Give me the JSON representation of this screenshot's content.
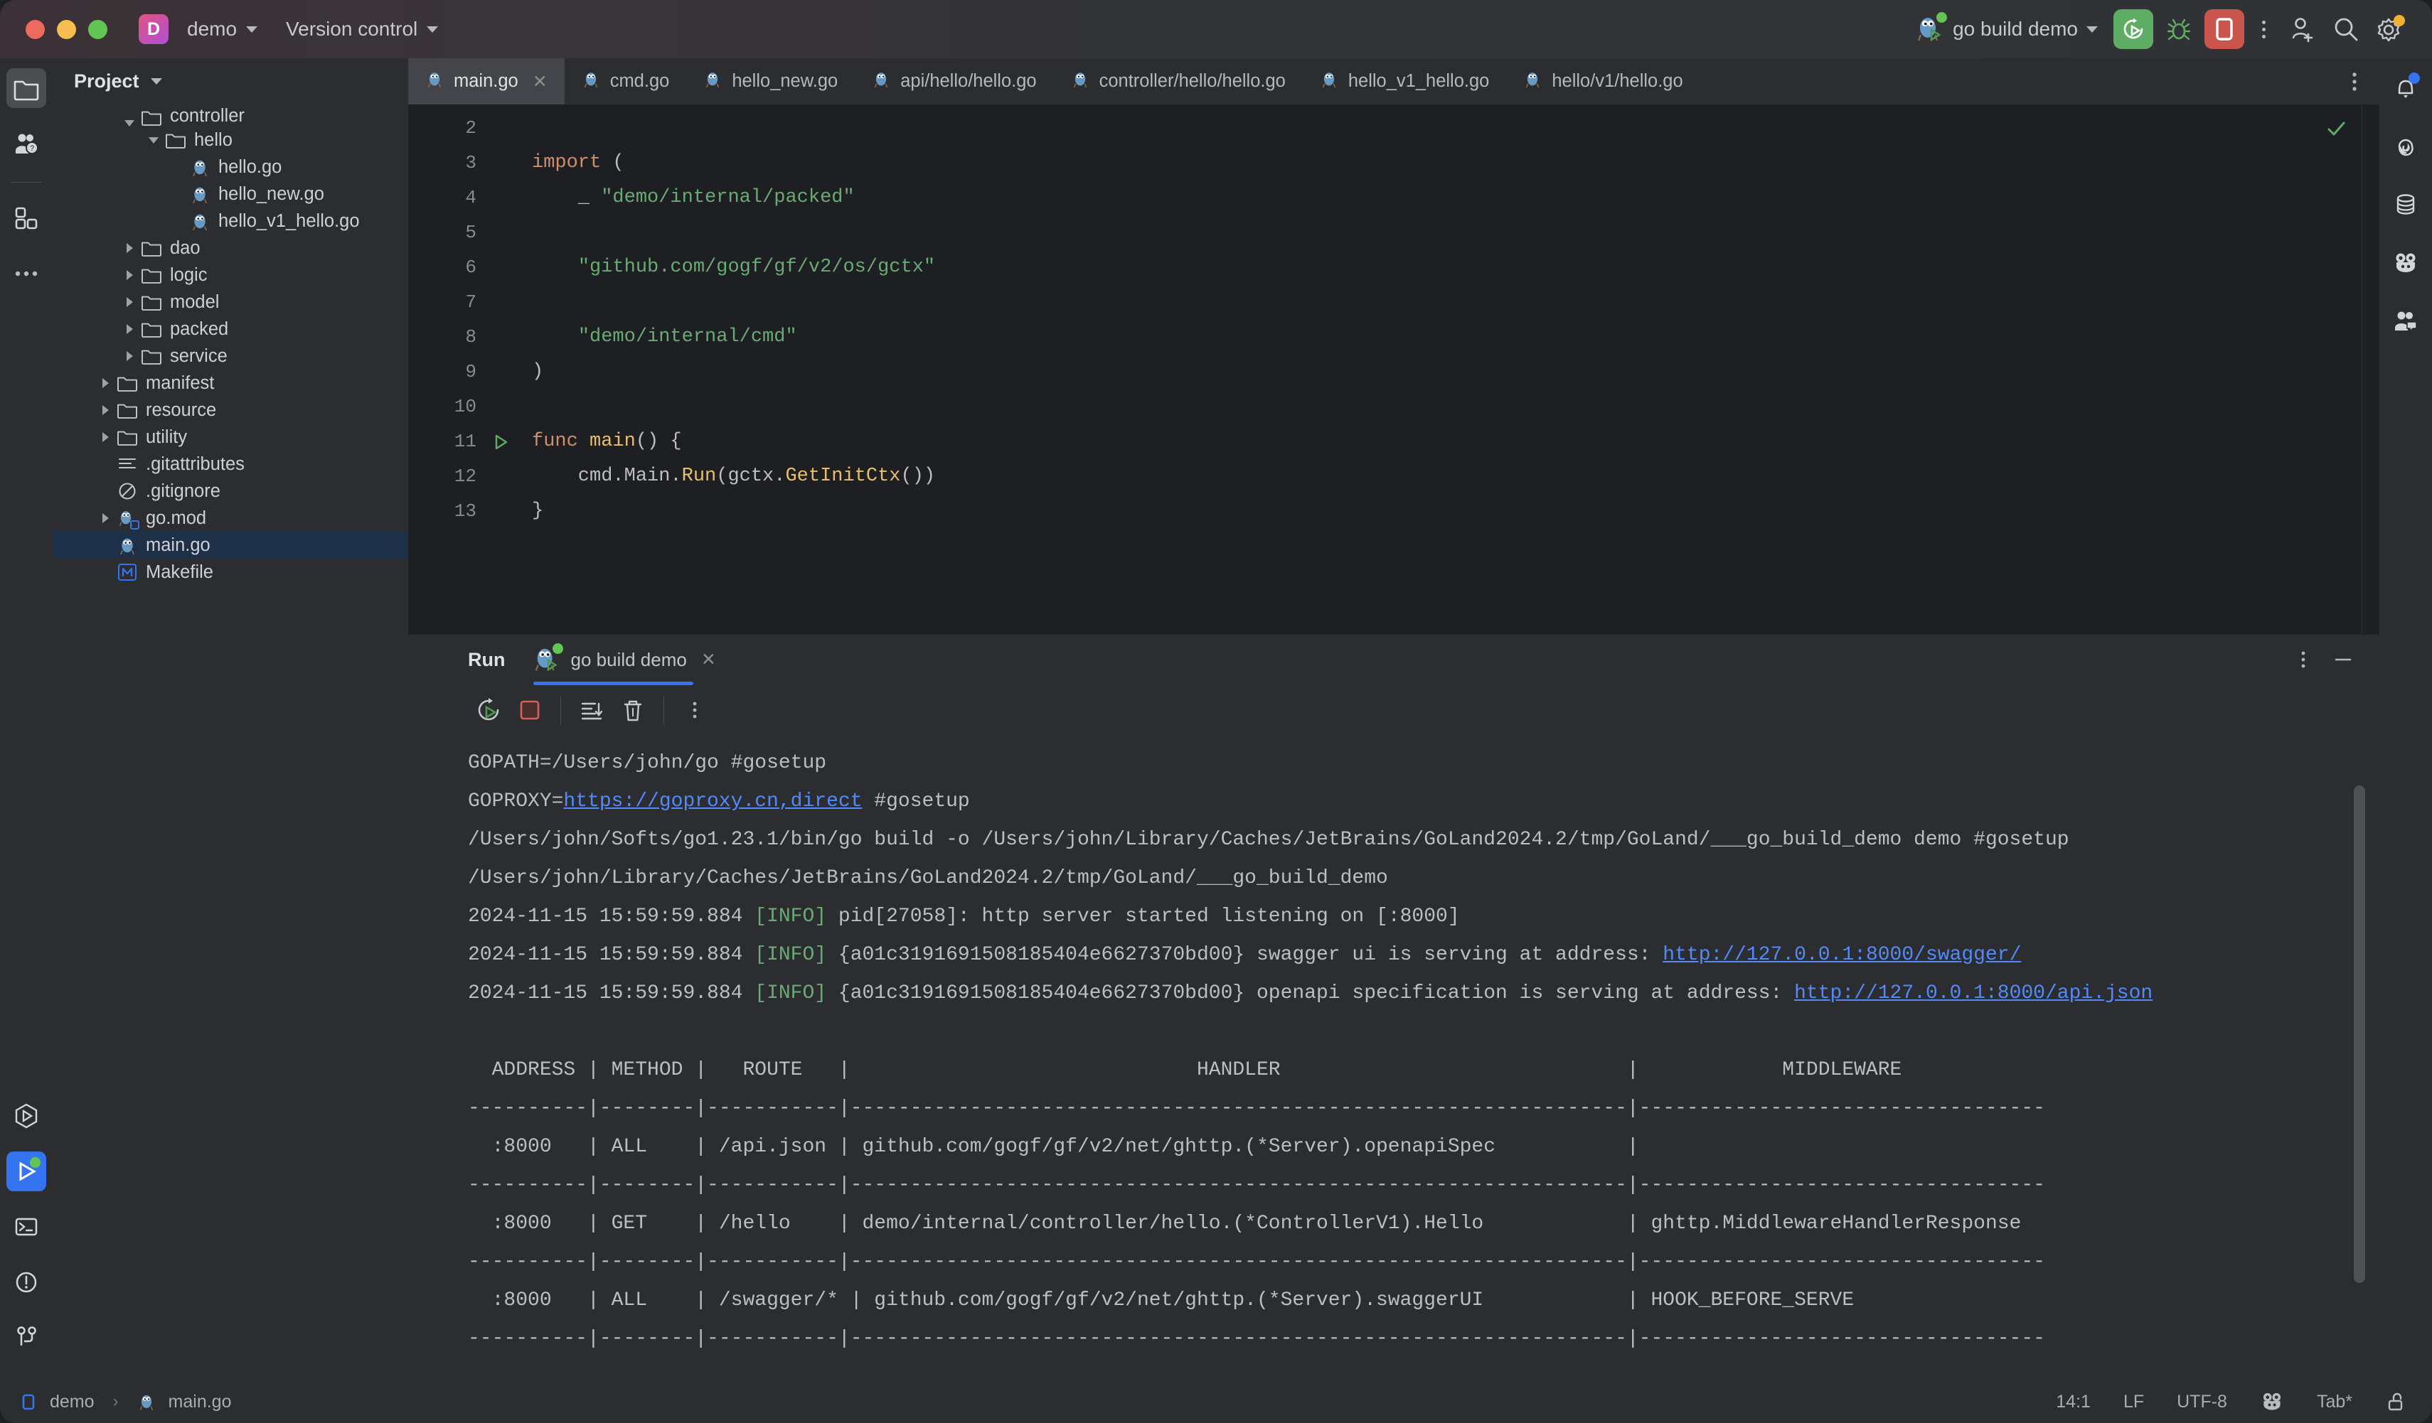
{
  "titlebar": {
    "project_badge": "D",
    "project_name": "demo",
    "version_control": "Version control",
    "run_config": "go build demo",
    "icons": {
      "run": "run-icon",
      "debug": "debug-bug-icon",
      "stop": "stop-icon",
      "more": "more-options-icon",
      "share": "add-user-icon",
      "search": "search-icon",
      "settings": "settings-gear-icon"
    }
  },
  "left_rail": [
    {
      "name": "project-tool-window",
      "icon": "folder-icon",
      "active": true
    },
    {
      "name": "assistant-tool-window",
      "icon": "people-question-icon",
      "active": false
    },
    {
      "name": "plugins-tool-window",
      "icon": "squares-icon",
      "active": false
    },
    {
      "name": "more-tool-windows",
      "icon": "ellipsis-icon",
      "active": false
    }
  ],
  "left_rail_bottom": [
    {
      "name": "run-anything",
      "icon": "hexagon-play-icon",
      "active": false
    },
    {
      "name": "run-tool-window",
      "icon": "play-icon",
      "active": true
    },
    {
      "name": "terminal-tool-window",
      "icon": "terminal-icon",
      "active": false
    },
    {
      "name": "problems-tool-window",
      "icon": "warning-circle-icon",
      "active": false
    },
    {
      "name": "version-control-tool-window",
      "icon": "branch-icon",
      "active": false
    }
  ],
  "right_rail": [
    {
      "name": "notifications",
      "icon": "bell-icon",
      "badge": true
    },
    {
      "name": "ai-assistant",
      "icon": "spiral-icon",
      "badge": false
    },
    {
      "name": "database",
      "icon": "database-icon",
      "badge": false
    },
    {
      "name": "gradle-or-frog",
      "icon": "frog-icon",
      "badge": false
    },
    {
      "name": "code-with-me",
      "icon": "people-chat-icon",
      "badge": false
    }
  ],
  "project_panel": {
    "title": "Project",
    "tree": [
      {
        "label": "controller",
        "depth": 2,
        "twisty": "down",
        "icon": "folder-icon",
        "clipped": true
      },
      {
        "label": "hello",
        "depth": 3,
        "twisty": "down",
        "icon": "folder-icon"
      },
      {
        "label": "hello.go",
        "depth": 4,
        "twisty": "none",
        "icon": "go-file-icon"
      },
      {
        "label": "hello_new.go",
        "depth": 4,
        "twisty": "none",
        "icon": "go-file-icon"
      },
      {
        "label": "hello_v1_hello.go",
        "depth": 4,
        "twisty": "none",
        "icon": "go-file-icon"
      },
      {
        "label": "dao",
        "depth": 2,
        "twisty": "right",
        "icon": "folder-icon"
      },
      {
        "label": "logic",
        "depth": 2,
        "twisty": "right",
        "icon": "folder-icon"
      },
      {
        "label": "model",
        "depth": 2,
        "twisty": "right",
        "icon": "folder-icon"
      },
      {
        "label": "packed",
        "depth": 2,
        "twisty": "right",
        "icon": "folder-icon"
      },
      {
        "label": "service",
        "depth": 2,
        "twisty": "right",
        "icon": "folder-icon"
      },
      {
        "label": "manifest",
        "depth": 1,
        "twisty": "right",
        "icon": "folder-icon"
      },
      {
        "label": "resource",
        "depth": 1,
        "twisty": "right",
        "icon": "folder-icon"
      },
      {
        "label": "utility",
        "depth": 1,
        "twisty": "right",
        "icon": "folder-icon"
      },
      {
        "label": ".gitattributes",
        "depth": 1,
        "twisty": "none",
        "icon": "text-lines-icon"
      },
      {
        "label": ".gitignore",
        "depth": 1,
        "twisty": "none",
        "icon": "ignore-circle-icon"
      },
      {
        "label": "go.mod",
        "depth": 1,
        "twisty": "right",
        "icon": "go-mod-icon"
      },
      {
        "label": "main.go",
        "depth": 1,
        "twisty": "none",
        "icon": "go-file-icon",
        "selected": true
      },
      {
        "label": "Makefile",
        "depth": 1,
        "twisty": "none",
        "icon": "makefile-icon"
      }
    ]
  },
  "editor": {
    "tabs": [
      {
        "label": "main.go",
        "icon": "go-file-icon",
        "active": true,
        "closable": true
      },
      {
        "label": "cmd.go",
        "icon": "go-file-icon",
        "active": false
      },
      {
        "label": "hello_new.go",
        "icon": "go-file-icon",
        "active": false
      },
      {
        "label": "api/hello/hello.go",
        "icon": "go-file-icon",
        "active": false
      },
      {
        "label": "controller/hello/hello.go",
        "icon": "go-file-icon",
        "active": false
      },
      {
        "label": "hello_v1_hello.go",
        "icon": "go-file-icon",
        "active": false
      },
      {
        "label": "hello/v1/hello.go",
        "icon": "go-file-icon",
        "active": false
      }
    ],
    "tab_options_icon": "kebab-menu-icon",
    "first_visible_line": 2,
    "lines": [
      {
        "num": 2,
        "tokens": [],
        "gutter_mark": ""
      },
      {
        "num": 3,
        "tokens": [
          {
            "t": "import ",
            "c": "kw"
          },
          {
            "t": "(",
            "c": "plain"
          }
        ],
        "gutter_mark": ""
      },
      {
        "num": 4,
        "tokens": [
          {
            "t": "    _ ",
            "c": "plain"
          },
          {
            "t": "\"demo/internal/packed\"",
            "c": "str"
          }
        ],
        "gutter_mark": ""
      },
      {
        "num": 5,
        "tokens": [],
        "gutter_mark": ""
      },
      {
        "num": 6,
        "tokens": [
          {
            "t": "    ",
            "c": "plain"
          },
          {
            "t": "\"github.com/gogf/gf/v2/os/gctx\"",
            "c": "str"
          }
        ],
        "gutter_mark": ""
      },
      {
        "num": 7,
        "tokens": [],
        "gutter_mark": ""
      },
      {
        "num": 8,
        "tokens": [
          {
            "t": "    ",
            "c": "plain"
          },
          {
            "t": "\"demo/internal/cmd\"",
            "c": "str"
          }
        ],
        "gutter_mark": ""
      },
      {
        "num": 9,
        "tokens": [
          {
            "t": ")",
            "c": "plain"
          }
        ],
        "gutter_mark": ""
      },
      {
        "num": 10,
        "tokens": [],
        "gutter_mark": ""
      },
      {
        "num": 11,
        "tokens": [
          {
            "t": "func ",
            "c": "kw"
          },
          {
            "t": "main",
            "c": "fname"
          },
          {
            "t": "() {",
            "c": "plain"
          }
        ],
        "gutter_mark": "run-gutter-icon"
      },
      {
        "num": 12,
        "tokens": [
          {
            "t": "    cmd",
            "c": "plain"
          },
          {
            "t": ".Main.",
            "c": "plain"
          },
          {
            "t": "Run",
            "c": "fname"
          },
          {
            "t": "(gctx.",
            "c": "plain"
          },
          {
            "t": "GetInitCtx",
            "c": "fname"
          },
          {
            "t": "())",
            "c": "plain"
          }
        ],
        "gutter_mark": ""
      },
      {
        "num": 13,
        "tokens": [
          {
            "t": "}",
            "c": "plain"
          }
        ],
        "gutter_mark": ""
      }
    ],
    "inspection_status": "ok-check-icon"
  },
  "run_panel": {
    "label": "Run",
    "tab": {
      "label": "go build demo",
      "icon": "go-run-icon",
      "closable": true
    },
    "head_more_icon": "kebab-menu-icon",
    "minimize_icon": "minimize-icon",
    "toolbar": [
      {
        "name": "rerun-button",
        "icon": "rerun-icon"
      },
      {
        "name": "stop-button",
        "icon": "stop-square-icon"
      },
      {
        "name": "scroll-to-end-button",
        "icon": "scroll-end-icon"
      },
      {
        "name": "clear-all-button",
        "icon": "trash-icon"
      },
      {
        "name": "more-options-button",
        "icon": "kebab-menu-icon"
      }
    ],
    "console_lines": [
      [
        {
          "t": "GOPATH=/Users/john/go #gosetup",
          "c": "plain"
        }
      ],
      [
        {
          "t": "GOPROXY=",
          "c": "plain"
        },
        {
          "t": "https://goproxy.cn,direct",
          "c": "link"
        },
        {
          "t": " #gosetup",
          "c": "plain"
        }
      ],
      [
        {
          "t": "/Users/john/Softs/go1.23.1/bin/go build -o /Users/john/Library/Caches/JetBrains/GoLand2024.2/tmp/GoLand/___go_build_demo demo #gosetup",
          "c": "plain"
        }
      ],
      [
        {
          "t": "/Users/john/Library/Caches/JetBrains/GoLand2024.2/tmp/GoLand/___go_build_demo",
          "c": "plain"
        }
      ],
      [
        {
          "t": "2024-11-15 15:59:59.884 ",
          "c": "plain"
        },
        {
          "t": "[INFO]",
          "c": "info"
        },
        {
          "t": " pid[27058]: http server started listening on [:8000]",
          "c": "plain"
        }
      ],
      [
        {
          "t": "2024-11-15 15:59:59.884 ",
          "c": "plain"
        },
        {
          "t": "[INFO]",
          "c": "info"
        },
        {
          "t": " {a01c3191691508185404e6627370bd00} swagger ui is serving at address: ",
          "c": "plain"
        },
        {
          "t": "http://127.0.0.1:8000/swagger/",
          "c": "link"
        }
      ],
      [
        {
          "t": "2024-11-15 15:59:59.884 ",
          "c": "plain"
        },
        {
          "t": "[INFO]",
          "c": "info"
        },
        {
          "t": " {a01c3191691508185404e6627370bd00} openapi specification is serving at address: ",
          "c": "plain"
        },
        {
          "t": "http://127.0.0.1:8000/api.json",
          "c": "link"
        }
      ],
      [
        {
          "t": "",
          "c": "plain"
        }
      ],
      [
        {
          "t": "  ADDRESS | METHOD |   ROUTE   |                             HANDLER                             |            MIDDLEWARE            ",
          "c": "plain"
        }
      ],
      [
        {
          "t": "----------|--------|-----------|-----------------------------------------------------------------|----------------------------------",
          "c": "plain"
        }
      ],
      [
        {
          "t": "  :8000   | ALL    | /api.json | github.com/gogf/gf/v2/net/ghttp.(*Server).openapiSpec           |                                  ",
          "c": "plain"
        }
      ],
      [
        {
          "t": "----------|--------|-----------|-----------------------------------------------------------------|----------------------------------",
          "c": "plain"
        }
      ],
      [
        {
          "t": "  :8000   | GET    | /hello    | demo/internal/controller/hello.(*ControllerV1).Hello            | ghttp.MiddlewareHandlerResponse  ",
          "c": "plain"
        }
      ],
      [
        {
          "t": "----------|--------|-----------|-----------------------------------------------------------------|----------------------------------",
          "c": "plain"
        }
      ],
      [
        {
          "t": "  :8000   | ALL    | /swagger/* | github.com/gogf/gf/v2/net/ghttp.(*Server).swaggerUI            | HOOK_BEFORE_SERVE                ",
          "c": "plain"
        }
      ],
      [
        {
          "t": "----------|--------|-----------|-----------------------------------------------------------------|----------------------------------",
          "c": "plain"
        }
      ]
    ],
    "route_table": {
      "type": "table",
      "columns": [
        "ADDRESS",
        "METHOD",
        "ROUTE",
        "HANDLER",
        "MIDDLEWARE"
      ],
      "rows": [
        [
          ":8000",
          "ALL",
          "/api.json",
          "github.com/gogf/gf/v2/net/ghttp.(*Server).openapiSpec",
          ""
        ],
        [
          ":8000",
          "GET",
          "/hello",
          "demo/internal/controller/hello.(*ControllerV1).Hello",
          "ghttp.MiddlewareHandlerResponse"
        ],
        [
          ":8000",
          "ALL",
          "/swagger/*",
          "github.com/gogf/gf/v2/net/ghttp.(*Server).swaggerUI",
          "HOOK_BEFORE_SERVE"
        ]
      ]
    }
  },
  "statusbar": {
    "breadcrumb_project": "demo",
    "breadcrumb_file": "main.go",
    "caret": "14:1",
    "line_separator": "LF",
    "encoding": "UTF-8",
    "indent": "Tab*",
    "frog_icon": "frog-icon",
    "lock_icon": "unlocked-icon"
  },
  "colors": {
    "accent_blue": "#3574f0",
    "run_green": "#5fad65",
    "stop_red": "#c9554d",
    "string_green": "#6aab73",
    "keyword_orange": "#cf8e6d",
    "func_yellow": "#e8bf6a",
    "link_blue": "#548af7",
    "panel_bg": "#2b2d30",
    "editor_bg": "#1e1f22",
    "selection_blue": "#1d3048"
  }
}
